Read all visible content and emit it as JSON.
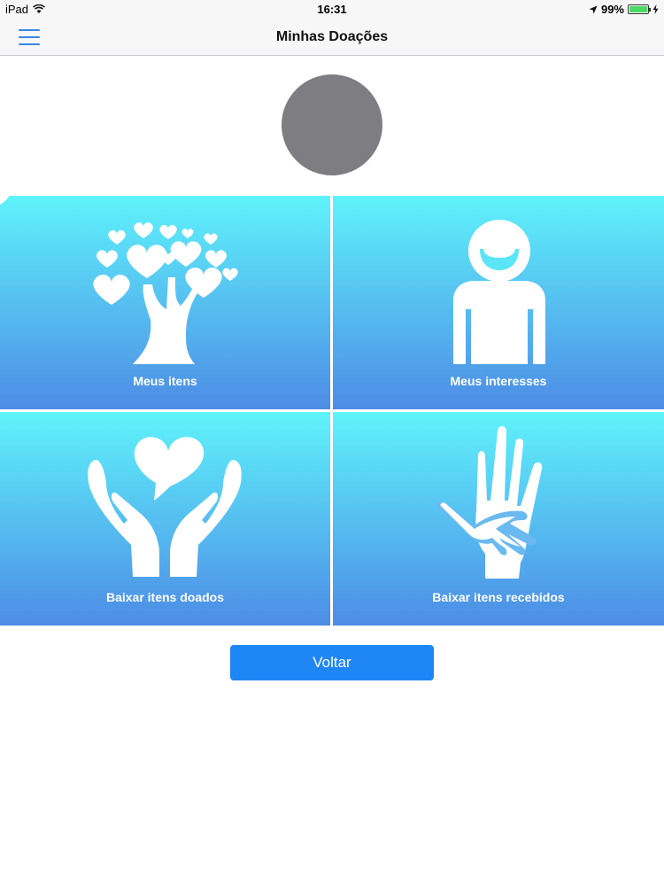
{
  "status_bar": {
    "device": "iPad",
    "time": "16:31",
    "battery_percent": "99%",
    "battery_level": 0.99,
    "icons": [
      "wifi-icon",
      "location-arrow-icon",
      "battery-icon",
      "charging-icon"
    ]
  },
  "nav": {
    "title": "Minhas Doações",
    "menu_icon": "hamburger-menu-icon"
  },
  "avatar": {
    "color": "#7e7d82"
  },
  "tiles": [
    {
      "label": "Meus itens",
      "icon": "heart-tree-icon"
    },
    {
      "label": "Meus interesses",
      "icon": "smiling-person-icon"
    },
    {
      "label": "Baixar itens doados",
      "icon": "hands-holding-heart-icon"
    },
    {
      "label": "Baixar itens recebidos",
      "icon": "helping-hands-icon"
    }
  ],
  "back_button": {
    "label": "Voltar"
  },
  "colors": {
    "accent": "#1f86f5",
    "tile_gradient_top": "#5ff3fb",
    "tile_gradient_bottom": "#4d8ce6",
    "menu_icon": "#3a86e8"
  }
}
